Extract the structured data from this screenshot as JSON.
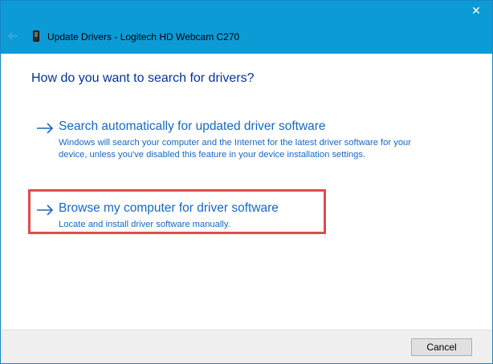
{
  "window": {
    "title": "Update Drivers - Logitech HD Webcam C270",
    "close_glyph": "✕",
    "titlebar_color": "#0d9bd6"
  },
  "heading": "How do you want to search for drivers?",
  "options": [
    {
      "title": "Search automatically for updated driver software",
      "description": "Windows will search your computer and the Internet for the latest driver software for your device, unless you've disabled this feature in your device installation settings.",
      "icon": "arrow-right-icon"
    },
    {
      "title": "Browse my computer for driver software",
      "description": "Locate and install driver software manually.",
      "icon": "arrow-right-icon",
      "highlighted": true
    }
  ],
  "footer": {
    "cancel_label": "Cancel"
  },
  "colors": {
    "accent": "#1668c2",
    "heading": "#003399",
    "highlight": "#df4c4c"
  }
}
